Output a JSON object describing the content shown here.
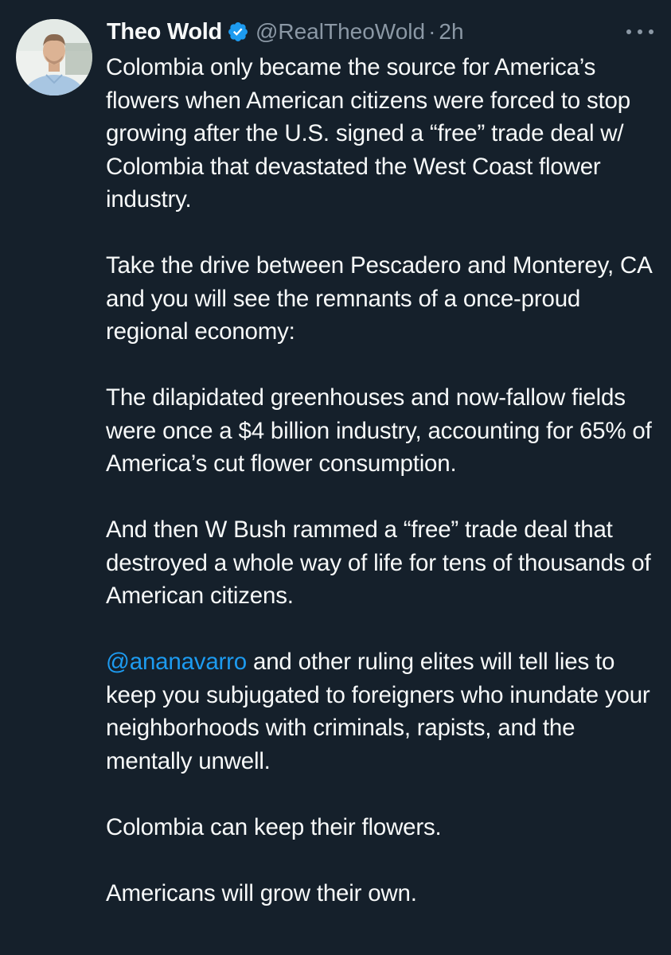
{
  "tweet": {
    "author_name": "Theo Wold",
    "handle": "@RealTheoWold",
    "separator": "·",
    "time": "2h",
    "paragraphs": [
      {
        "text": "Colombia only became the source for America’s flowers when American citizens were forced to stop growing after the U.S. signed a “free” trade deal w/ Colombia that devastated the West Coast flower industry."
      },
      {
        "text": "Take the drive between Pescadero and Monterey, CA and you will see the remnants of a once-proud regional economy:"
      },
      {
        "text": "The dilapidated greenhouses and now-fallow fields were once a $4 billion industry, accounting for 65% of America’s cut flower consumption."
      },
      {
        "text": "And then W Bush rammed a “free” trade deal that destroyed a whole way of life for tens of thousands of American citizens."
      },
      {
        "mention": "@ananavarro",
        "text": " and other ruling elites will tell lies to keep you subjugated to foreigners who inundate your neighborhoods with criminals, rapists, and the mentally unwell."
      },
      {
        "text": "Colombia can keep their flowers."
      },
      {
        "text": "Americans will grow their own."
      }
    ]
  },
  "icons": {
    "verified": "verified-badge-icon",
    "more": "more-options-icon"
  },
  "colors": {
    "background": "#15202b",
    "text": "#f7f9f9",
    "secondary_text": "#8b98a5",
    "link": "#1d9bf0",
    "verified": "#1d9bf0"
  }
}
